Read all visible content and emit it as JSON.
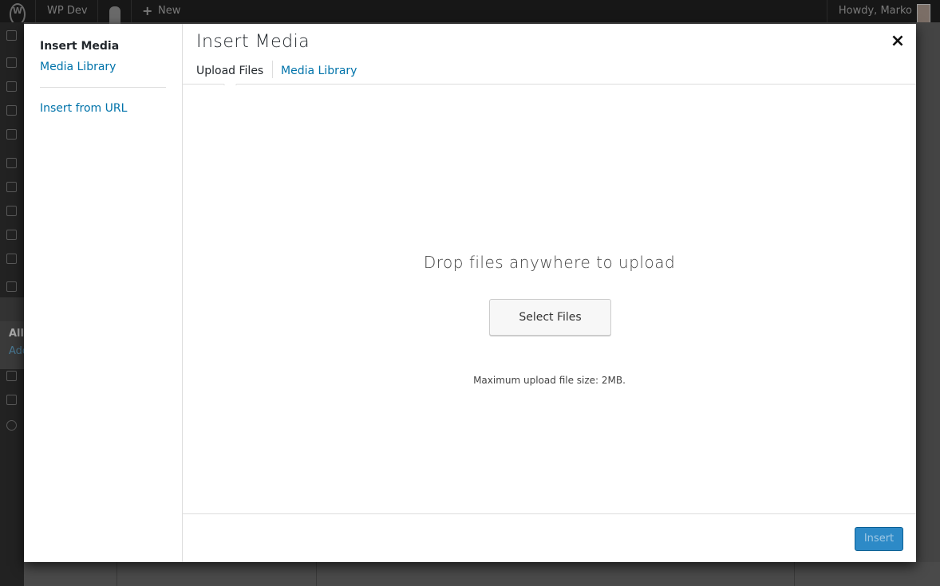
{
  "admin_bar": {
    "site_name": "WP Dev",
    "new_label": "New",
    "howdy": "Howdy, Marko"
  },
  "admin_sidebar": {
    "sub_all": "All",
    "sub_add": "Add"
  },
  "modal": {
    "menu": {
      "heading": "Insert Media",
      "media_library": "Media Library",
      "insert_from_url": "Insert from URL"
    },
    "title": "Insert Media",
    "close_icon": "×",
    "tabs": [
      {
        "label": "Upload Files",
        "active": true
      },
      {
        "label": "Media Library",
        "active": false
      }
    ],
    "uploader": {
      "drop_text": "Drop files anywhere to upload",
      "select_button": "Select Files",
      "max_size": "Maximum upload file size: 2MB."
    },
    "toolbar": {
      "insert_button": "Insert",
      "insert_disabled": true,
      "accent": "#2d8ac7"
    }
  }
}
